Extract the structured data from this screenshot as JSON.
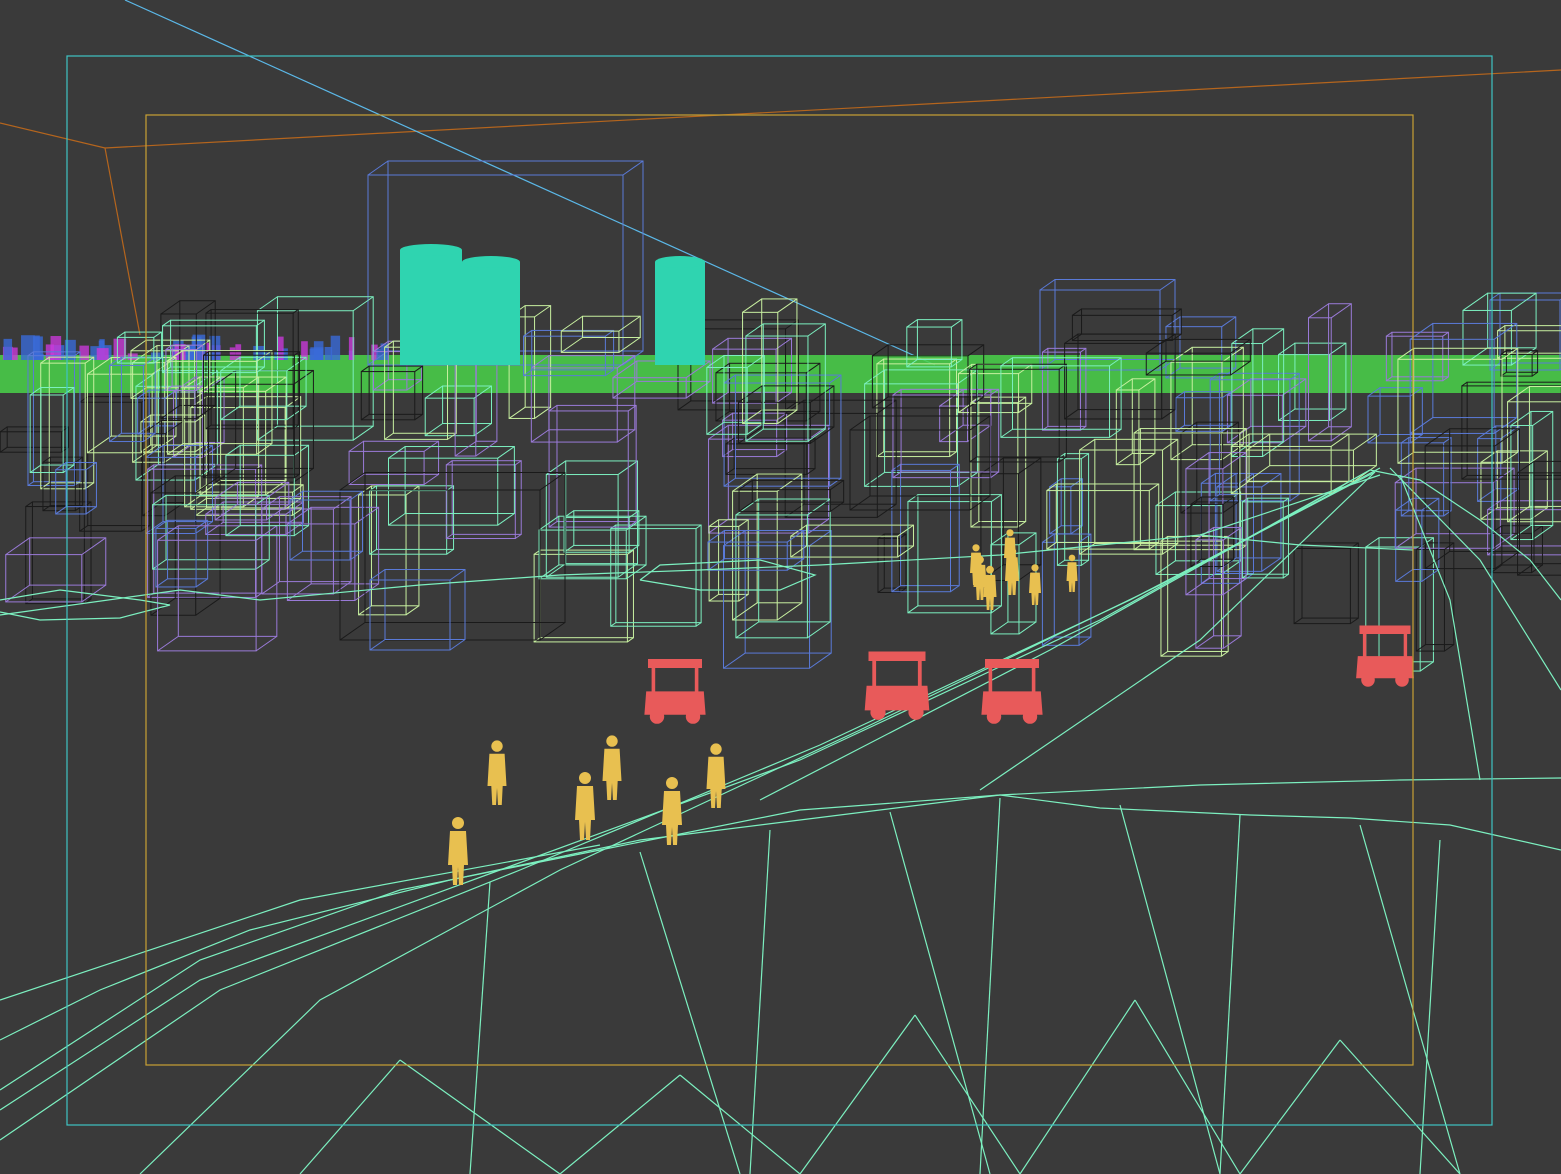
{
  "viewport": {
    "view": "perspective",
    "shading": "wireframe",
    "background_color": "#3a3a3a"
  },
  "overlays": {
    "safe_frame_outer_color": "#3fc4c4",
    "safe_frame_inner_color": "#c8a033",
    "camera_line_color": "#5bb8e8",
    "horizon_line_color": "#b5651d"
  },
  "scene": {
    "terrain_wire_color": "#7cf0c0",
    "building_wire_colors": [
      "#5a7ad8",
      "#9a7ad8",
      "#c8f0a0",
      "#1a1a1a",
      "#7cf0c0"
    ],
    "skyline_colors": [
      "#4ad44a",
      "#3a6ad8",
      "#c83ad8"
    ],
    "tower_color": "#2fd4b0",
    "tower_count": 3,
    "people_color": "#e8c050",
    "people_count": 13,
    "carts_color": "#e85a5a",
    "carts_count": 4
  }
}
